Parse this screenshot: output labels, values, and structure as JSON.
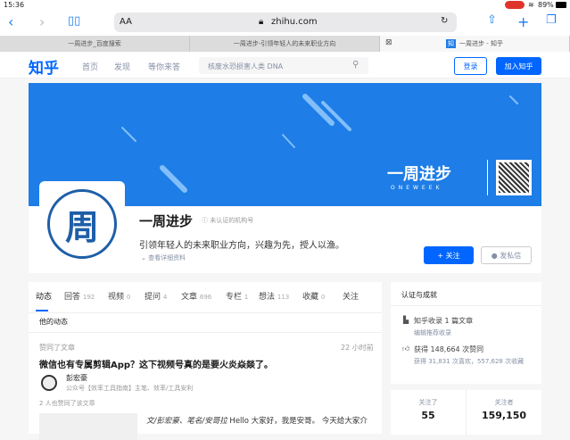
{
  "status": {
    "time": "15:36",
    "battery": "89%"
  },
  "browser": {
    "text_size": "AA",
    "url": "zhihu.com",
    "tabs": [
      {
        "label": "一周进步_百度搜索"
      },
      {
        "label": "一周进步-引领年轻人的未来职业方向"
      },
      {
        "label": "一周进步 - 知乎"
      }
    ]
  },
  "header": {
    "logo": "知乎",
    "nav": [
      "首页",
      "发现",
      "等你来答"
    ],
    "search_placeholder": "核废水恐损害人类 DNA",
    "login": "登录",
    "join": "加入知乎"
  },
  "banner": {
    "brand": "一周进步",
    "brand_en": "ONEWEEK"
  },
  "profile": {
    "avatar_char": "周",
    "name": "一周进步",
    "badge": "未认证的机构号",
    "bio": "引领年轻人的未来职业方向，兴趣为先，授人以渔。",
    "details": "查看详细资料",
    "follow": "关注",
    "message": "发私信"
  },
  "tabs": [
    {
      "label": "动态",
      "count": ""
    },
    {
      "label": "回答",
      "count": "192"
    },
    {
      "label": "视频",
      "count": "0"
    },
    {
      "label": "提问",
      "count": "4"
    },
    {
      "label": "文章",
      "count": "696"
    },
    {
      "label": "专栏",
      "count": "1"
    },
    {
      "label": "想法",
      "count": "113"
    },
    {
      "label": "收藏",
      "count": "0"
    },
    {
      "label": "关注",
      "count": ""
    }
  ],
  "feed": {
    "section": "他的动态",
    "item": {
      "action": "赞同了文章",
      "time": "22 小时前",
      "title": "微信也有专属剪辑App？这下视频号真的是要火炎焱燚了。",
      "author": "彭宏豪",
      "author_desc": "公众号【效率工具指南】主笔、效率/工具安利",
      "likes": "2 人也赞同了该文章",
      "excerpt_italic": "文/彭宏豪、笔名/安哥拉",
      "excerpt": " Hello 大家好，我是安哥。 今天给大家介"
    }
  },
  "achievements": {
    "title": "认证与成就",
    "included": "知乎收录 1 篇文章",
    "included_link": "编辑推荐收录",
    "votes": "获得 148,664 次赞同",
    "votes_detail": "获得 31,831 次喜欢，557,628 次收藏"
  },
  "follow_stats": {
    "following_label": "关注了",
    "following": "55",
    "followers_label": "关注者",
    "followers": "159,150"
  },
  "colors": {
    "accent": "#0066ff",
    "banner": "#1e7de6"
  }
}
